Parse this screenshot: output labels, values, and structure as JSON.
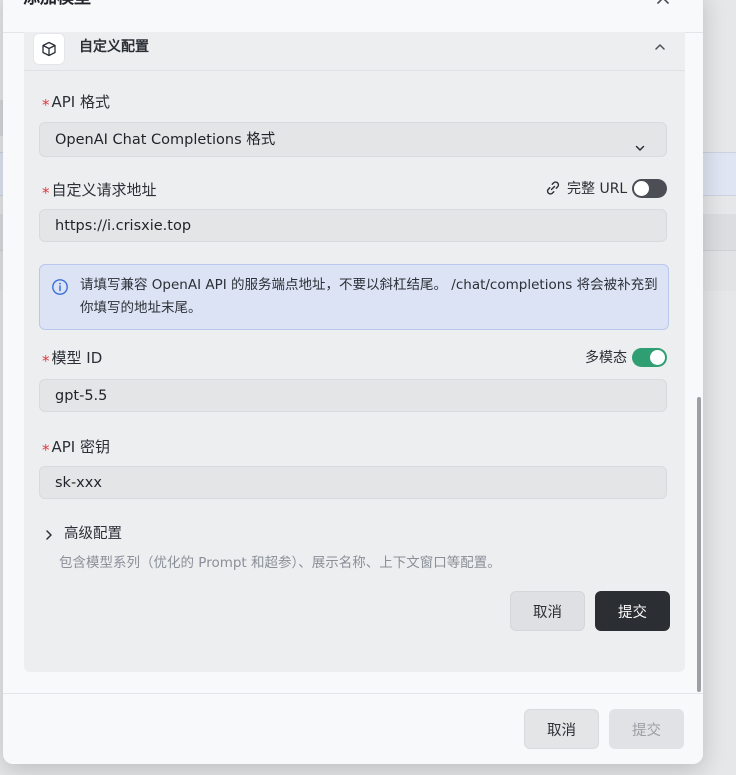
{
  "dialog": {
    "title": "添加模型",
    "section_title": "自定义配置",
    "api_format": {
      "label": "API 格式",
      "value": "OpenAI Chat Completions 格式"
    },
    "endpoint": {
      "label": "自定义请求地址",
      "full_url_label": "完整 URL",
      "full_url_enabled": false,
      "value": "https://i.crisxie.top"
    },
    "info_text": "请填写兼容 OpenAI API 的服务端点地址，不要以斜杠结尾。 /chat/completions 将会被补充到你填写的地址末尾。",
    "model_id": {
      "label": "模型 ID",
      "multimodal_label": "多模态",
      "multimodal_enabled": true,
      "value": "gpt-5.5"
    },
    "api_key": {
      "label": "API 密钥",
      "value": "sk-xxx"
    },
    "advanced": {
      "title": "高级配置",
      "description": "包含模型系列（优化的 Prompt 和超参）、展示名称、上下文窗口等配置。"
    },
    "inner_buttons": {
      "cancel": "取消",
      "submit": "提交"
    },
    "footer_buttons": {
      "cancel": "取消",
      "submit": "提交"
    }
  },
  "colors": {
    "required_star": "#e0393e",
    "toggle_on": "#2f9e72",
    "toggle_off": "#4b4e54",
    "info_bg": "#dce3f4",
    "info_icon": "#3b6fd8",
    "submit_dark": "#2b2e33"
  },
  "icons": [
    "close-icon",
    "cube-icon",
    "chevron-up-icon",
    "chevron-down-icon",
    "link-icon",
    "info-icon",
    "chevron-right-icon"
  ]
}
